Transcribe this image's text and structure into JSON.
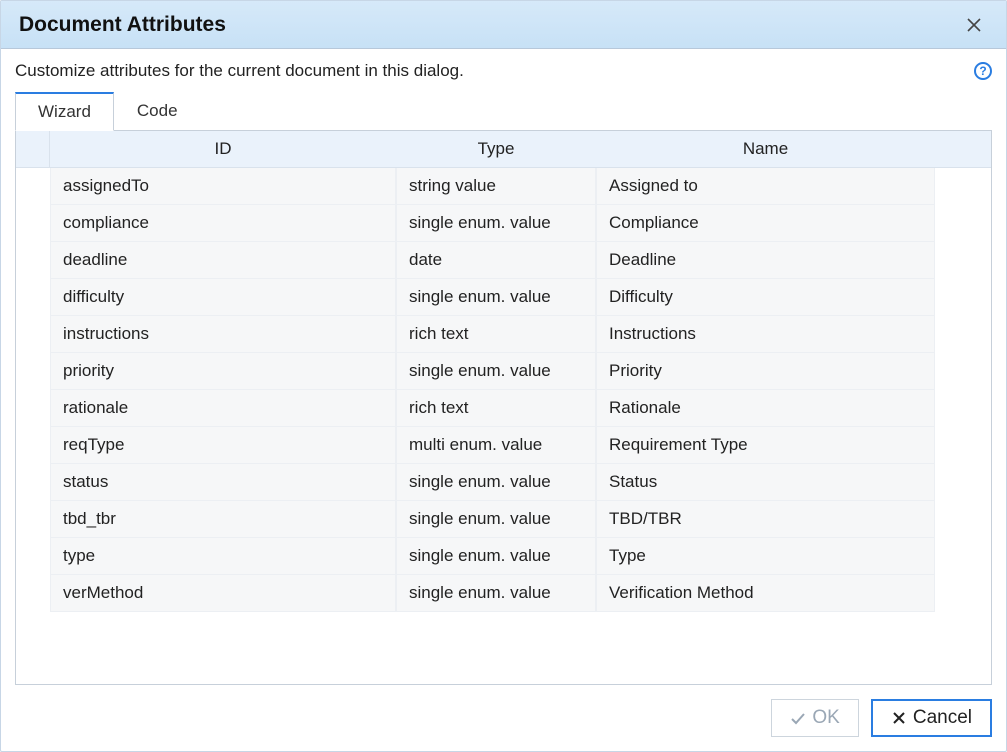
{
  "dialog": {
    "title": "Document Attributes",
    "subtitle": "Customize attributes for the current document in this dialog.",
    "help_glyph": "?"
  },
  "tabs": {
    "wizard": "Wizard",
    "code": "Code",
    "active": "wizard"
  },
  "columns": {
    "id": "ID",
    "type": "Type",
    "name": "Name"
  },
  "rows": [
    {
      "id": "assignedTo",
      "type": "string value",
      "name": "Assigned to"
    },
    {
      "id": "compliance",
      "type": "single enum. value",
      "name": "Compliance"
    },
    {
      "id": "deadline",
      "type": "date",
      "name": "Deadline"
    },
    {
      "id": "difficulty",
      "type": "single enum. value",
      "name": "Difficulty"
    },
    {
      "id": "instructions",
      "type": "rich text",
      "name": "Instructions"
    },
    {
      "id": "priority",
      "type": "single enum. value",
      "name": "Priority"
    },
    {
      "id": "rationale",
      "type": "rich text",
      "name": "Rationale"
    },
    {
      "id": "reqType",
      "type": "multi enum. value",
      "name": "Requirement Type"
    },
    {
      "id": "status",
      "type": "single enum. value",
      "name": "Status"
    },
    {
      "id": "tbd_tbr",
      "type": "single enum. value",
      "name": "TBD/TBR"
    },
    {
      "id": "type",
      "type": "single enum. value",
      "name": "Type"
    },
    {
      "id": "verMethod",
      "type": "single enum. value",
      "name": "Verification Method"
    }
  ],
  "buttons": {
    "ok": "OK",
    "cancel": "Cancel"
  }
}
